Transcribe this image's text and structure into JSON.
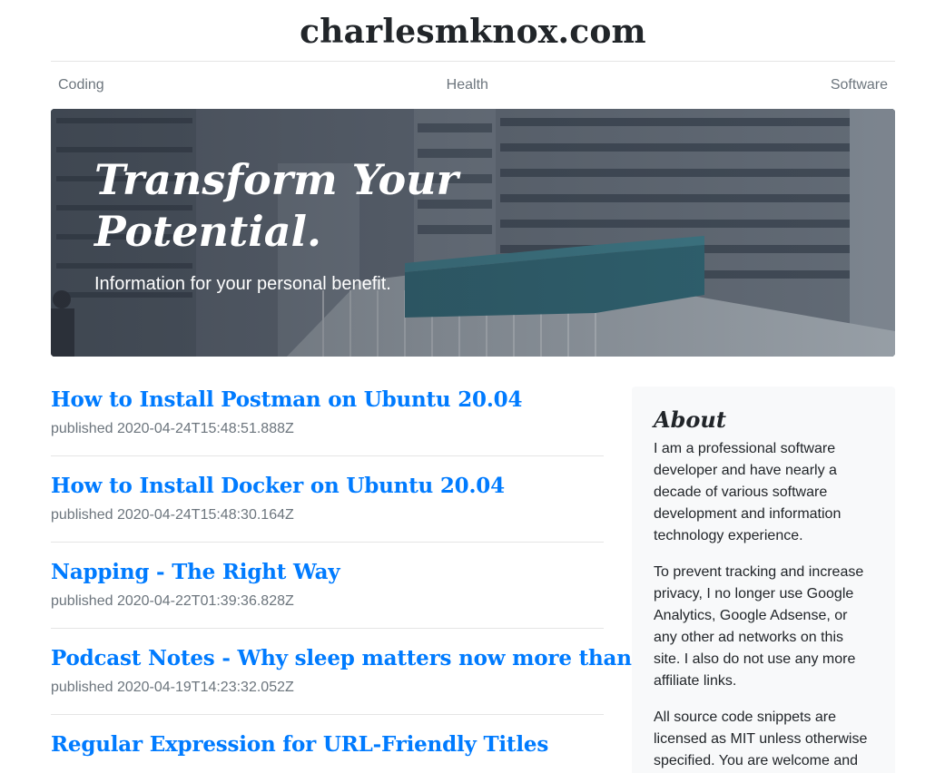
{
  "site": {
    "title": "charlesmknox.com"
  },
  "nav": {
    "items": [
      "Coding",
      "Health",
      "Software"
    ]
  },
  "hero": {
    "heading": "Transform Your Potential.",
    "lead": "Information for your personal benefit."
  },
  "posts": [
    {
      "title": "How to Install Postman on Ubuntu 20.04",
      "meta": "published 2020-04-24T15:48:51.888Z"
    },
    {
      "title": "How to Install Docker on Ubuntu 20.04",
      "meta": "published 2020-04-24T15:48:30.164Z"
    },
    {
      "title": "Napping - The Right Way",
      "meta": "published 2020-04-22T01:39:36.828Z"
    },
    {
      "title": "Podcast Notes - Why sleep matters now more than ever",
      "meta": "published 2020-04-19T14:23:32.052Z"
    },
    {
      "title": "Regular Expression for URL-Friendly Titles",
      "meta": ""
    }
  ],
  "sidebar": {
    "heading": "About",
    "paragraphs": [
      "I am a professional software developer and have nearly a decade of various software development and information technology experience.",
      "To prevent tracking and increase privacy, I no longer use Google Analytics, Google Adsense, or any other ad networks on this site. I also do not use any more affiliate links.",
      "All source code snippets are licensed as MIT unless otherwise specified. You are welcome and"
    ]
  },
  "colors": {
    "link": "#007bff",
    "muted": "#6c757d",
    "sidebar_bg": "#f8f9fa"
  }
}
